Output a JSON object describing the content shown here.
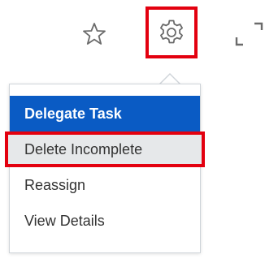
{
  "toolbar": {
    "star_icon": "star-outline-icon",
    "gear_icon": "gear-icon",
    "expand_icon": "expand-icon",
    "highlight_color": "#e3000f"
  },
  "menu": {
    "items": [
      {
        "label": "Delegate Task",
        "state": "active"
      },
      {
        "label": "Delete Incomplete",
        "state": "hovered"
      },
      {
        "label": "Reassign",
        "state": "normal"
      },
      {
        "label": "View Details",
        "state": "normal"
      }
    ],
    "active_color": "#0a5bc4"
  }
}
